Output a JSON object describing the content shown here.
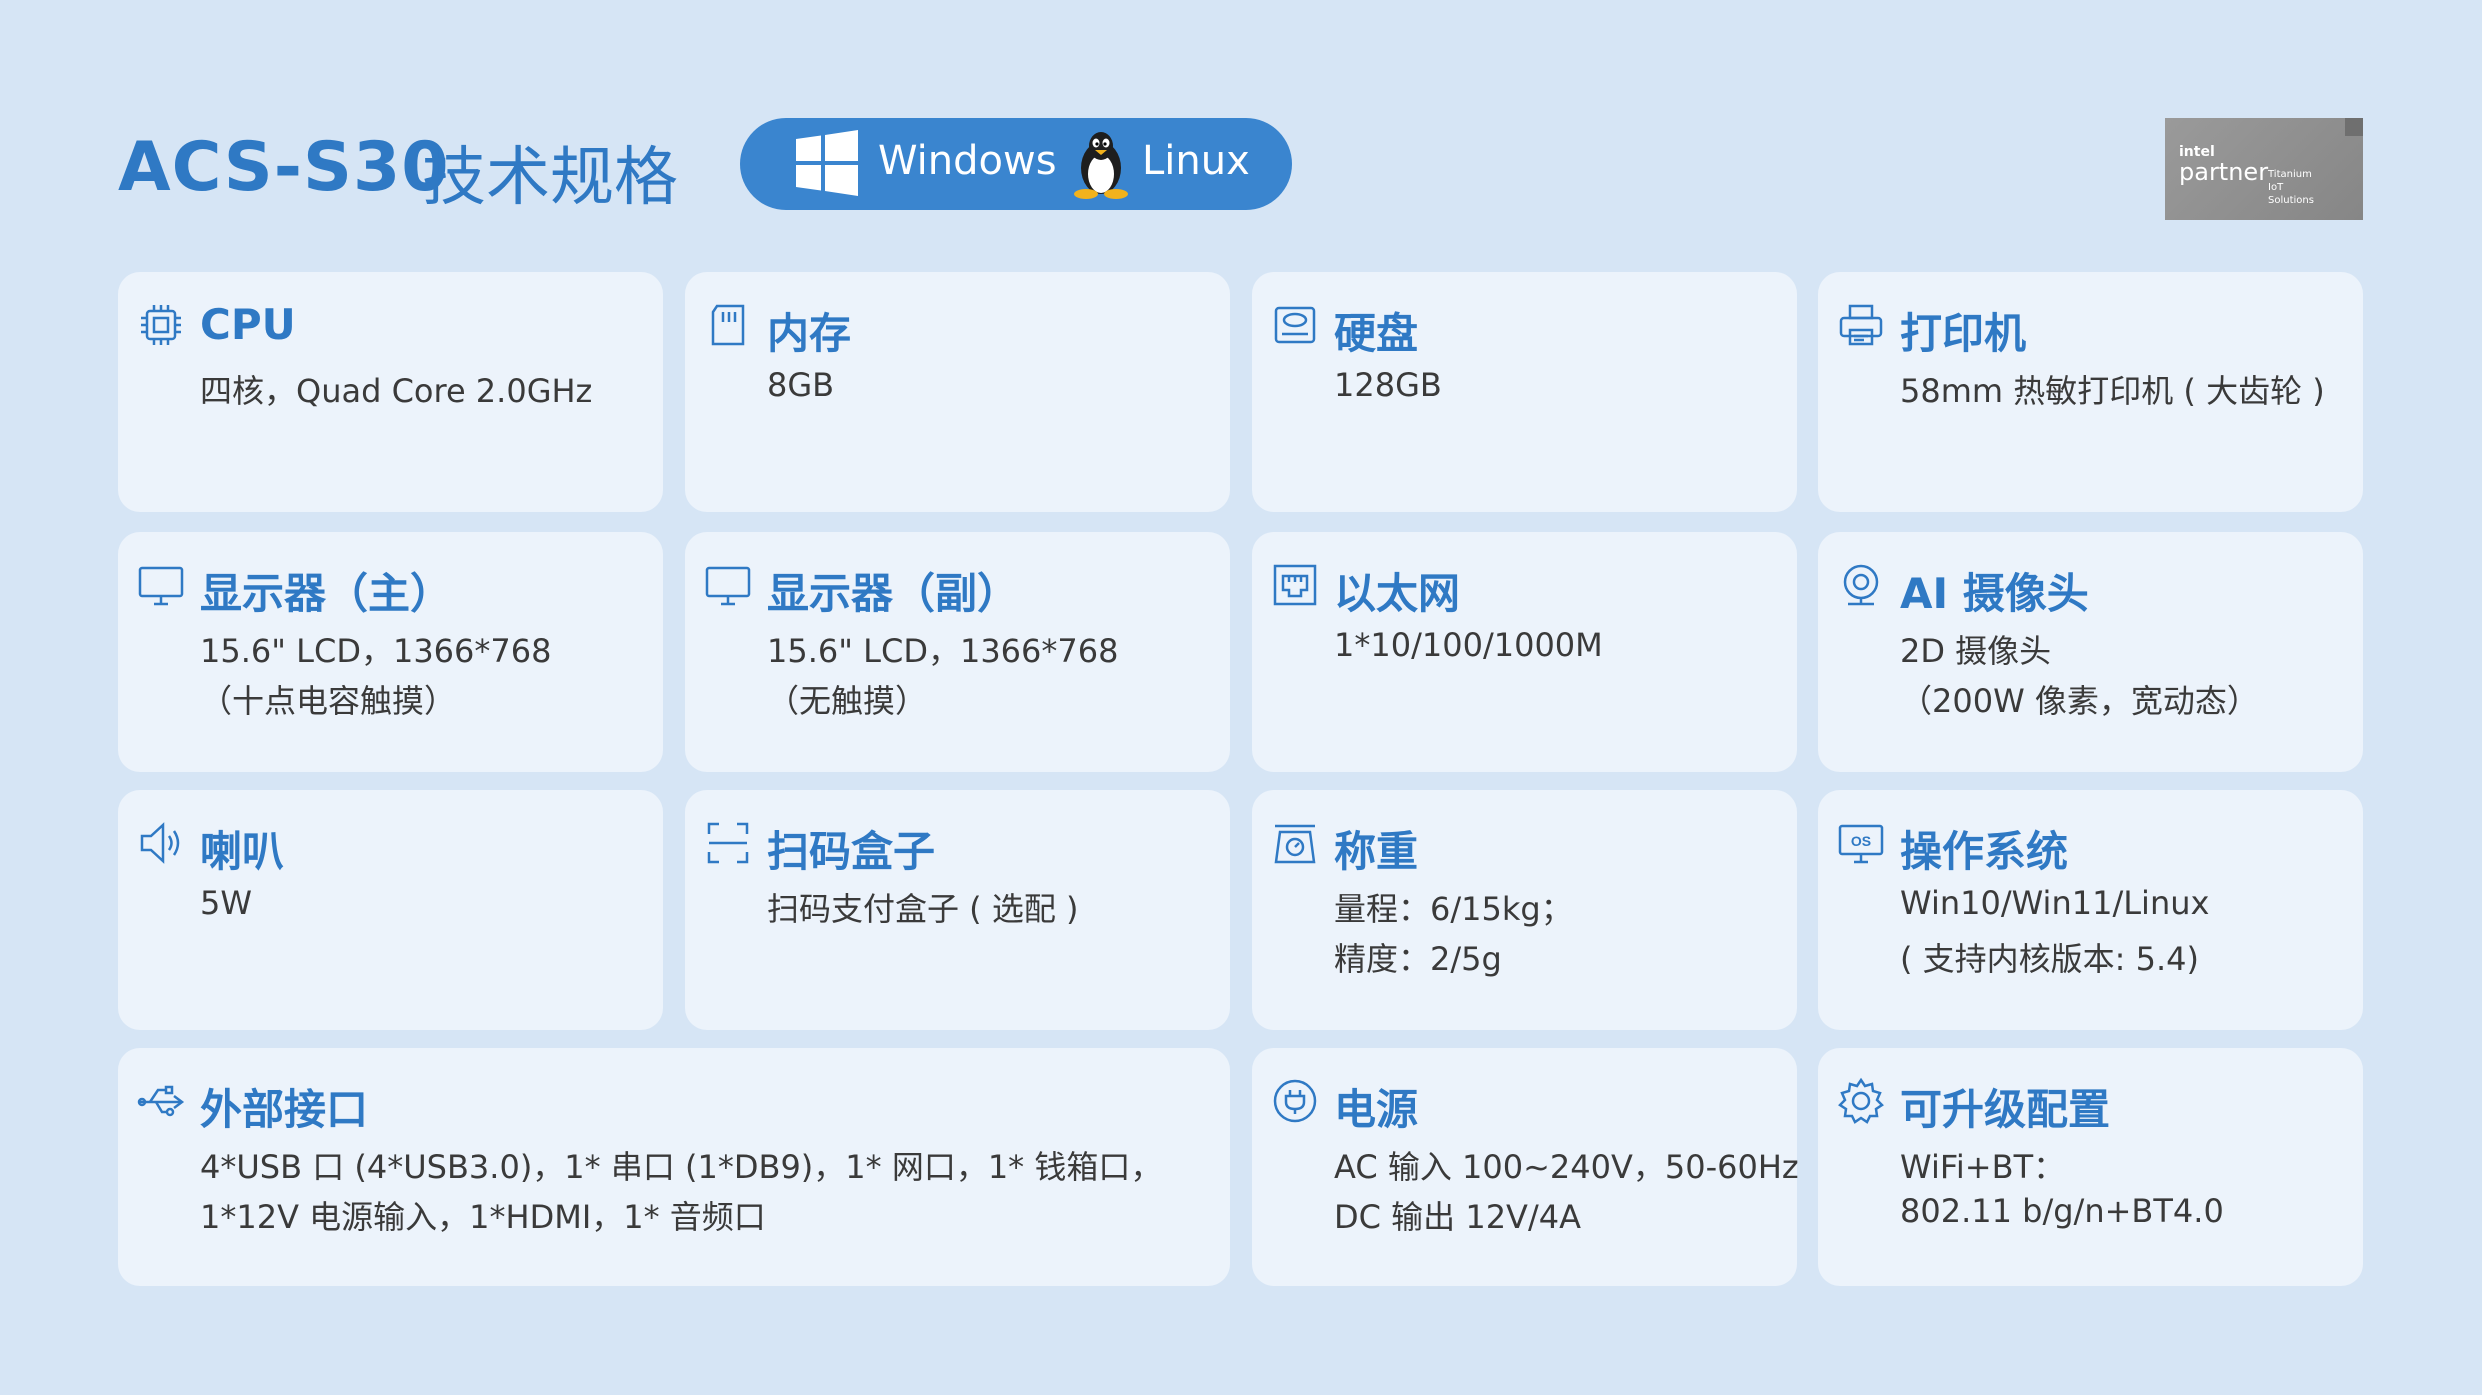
{
  "header": {
    "model": "ACS-S30",
    "subtitle": "技术规格",
    "os_windows": "Windows",
    "os_linux": "Linux",
    "badge": {
      "intel": "intel",
      "partner": "partner",
      "tier": [
        "Titanium",
        "IoT",
        "Solutions"
      ]
    }
  },
  "specs": [
    {
      "title": "CPU",
      "lines": [
        "四核，Quad Core 2.0GHz"
      ],
      "icon": "cpu-icon"
    },
    {
      "title": "内存",
      "lines": [
        "8GB"
      ],
      "icon": "memory-card-icon"
    },
    {
      "title": "硬盘",
      "lines": [
        "128GB"
      ],
      "icon": "hard-disk-icon"
    },
    {
      "title": "打印机",
      "lines": [
        "58mm 热敏打印机 ( 大齿轮 )"
      ],
      "icon": "printer-icon"
    },
    {
      "title": "显示器（主）",
      "lines": [
        "15.6\" LCD，1366*768",
        "（十点电容触摸）"
      ],
      "icon": "monitor-icon"
    },
    {
      "title": "显示器（副）",
      "lines": [
        "15.6\" LCD，1366*768",
        "（无触摸）"
      ],
      "icon": "monitor-icon"
    },
    {
      "title": "以太网",
      "lines": [
        "1*10/100/1000M"
      ],
      "icon": "ethernet-icon"
    },
    {
      "title": "AI 摄像头",
      "lines": [
        "2D 摄像头",
        "（200W 像素，宽动态）"
      ],
      "icon": "camera-icon"
    },
    {
      "title": "喇叭",
      "lines": [
        "5W"
      ],
      "icon": "speaker-icon"
    },
    {
      "title": "扫码盒子",
      "lines": [
        "扫码支付盒子 ( 选配 )"
      ],
      "icon": "scan-icon"
    },
    {
      "title": "称重",
      "lines": [
        "量程：6/15kg；",
        "精度：2/5g"
      ],
      "icon": "scale-icon"
    },
    {
      "title": "操作系统",
      "lines": [
        "Win10/Win11/Linux",
        "( 支持内核版本: 5.4)"
      ],
      "icon": "os-icon"
    },
    {
      "title": "外部接口",
      "lines": [
        "4*USB 口 (4*USB3.0)，1* 串口 (1*DB9)，1* 网口，1* 钱箱口，",
        "1*12V 电源输入，1*HDMI，1* 音频口"
      ],
      "icon": "usb-icon"
    },
    {
      "title": "电源",
      "lines": [
        "AC 输入 100~240V，50-60Hz",
        "DC 输出 12V/4A"
      ],
      "icon": "power-plug-icon"
    },
    {
      "title": "可升级配置",
      "lines": [
        "WiFi+BT：",
        "802.11 b/g/n+BT4.0"
      ],
      "icon": "gear-icon"
    }
  ],
  "colors": {
    "accent": "#2f79c4",
    "background": "#d6e5f5",
    "card": "#ecf3fb",
    "text": "#3a3a3a"
  }
}
